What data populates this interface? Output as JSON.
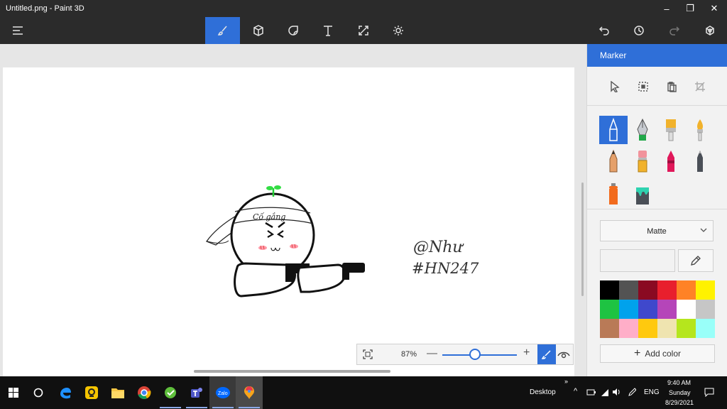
{
  "window": {
    "title": "Untitled.png - Paint 3D",
    "minimize": "–",
    "maximize": "❐",
    "close": "✕"
  },
  "toolbar": {
    "menu_icon": "menu-icon",
    "tools": [
      "brushes-icon",
      "3d-shapes-icon",
      "stickers-icon",
      "text-icon",
      "canvas-icon",
      "effects-icon"
    ],
    "active_tool": "brushes-icon",
    "right": [
      "undo-icon",
      "history-icon",
      "redo-icon",
      "mixed-reality-icon"
    ]
  },
  "drawing": {
    "headband_text": "Cố gắng",
    "signature_line1": "@Như",
    "signature_line2": "#HN247"
  },
  "zoom": {
    "percent": "87%",
    "minus": "—",
    "plus": "+",
    "level": 0.44
  },
  "panel": {
    "title": "Marker",
    "tools": [
      "select-icon",
      "crop-select-icon",
      "paste-icon",
      "crop-icon"
    ],
    "brushes": [
      {
        "name": "marker-brush",
        "active": true
      },
      {
        "name": "calligraphy-pen-brush"
      },
      {
        "name": "oil-brush"
      },
      {
        "name": "watercolor-brush"
      },
      {
        "name": "pencil-brush"
      },
      {
        "name": "eraser-brush"
      },
      {
        "name": "crayon-brush"
      },
      {
        "name": "pixel-pen-brush"
      },
      {
        "name": "spray-can-brush"
      },
      {
        "name": "fill-bucket"
      }
    ],
    "finish": "Matte",
    "add_color": "Add color",
    "palette": [
      "#000000",
      "#535353",
      "#8a0a22",
      "#e81f2d",
      "#ff8226",
      "#fff200",
      "#1ec342",
      "#00a2ec",
      "#3f48cc",
      "#b545b9",
      "#ffffff",
      "#c6c6c6",
      "#b97a57",
      "#ffaec8",
      "#ffc90e",
      "#efe4b0",
      "#b5e61d",
      "#99fff9"
    ]
  },
  "taskbar": {
    "apps": [
      "start-icon",
      "cortana-icon",
      "edge-icon",
      "search-app-icon",
      "file-explorer-icon",
      "chrome-icon",
      "app-icon",
      "teams-icon",
      "zalo-icon",
      "paint3d-icon"
    ],
    "zalo_label": "Zalo",
    "desktop_label": "Desktop",
    "lang": "ENG",
    "time": "9:40 AM",
    "day": "Sunday",
    "date": "8/29/2021"
  }
}
